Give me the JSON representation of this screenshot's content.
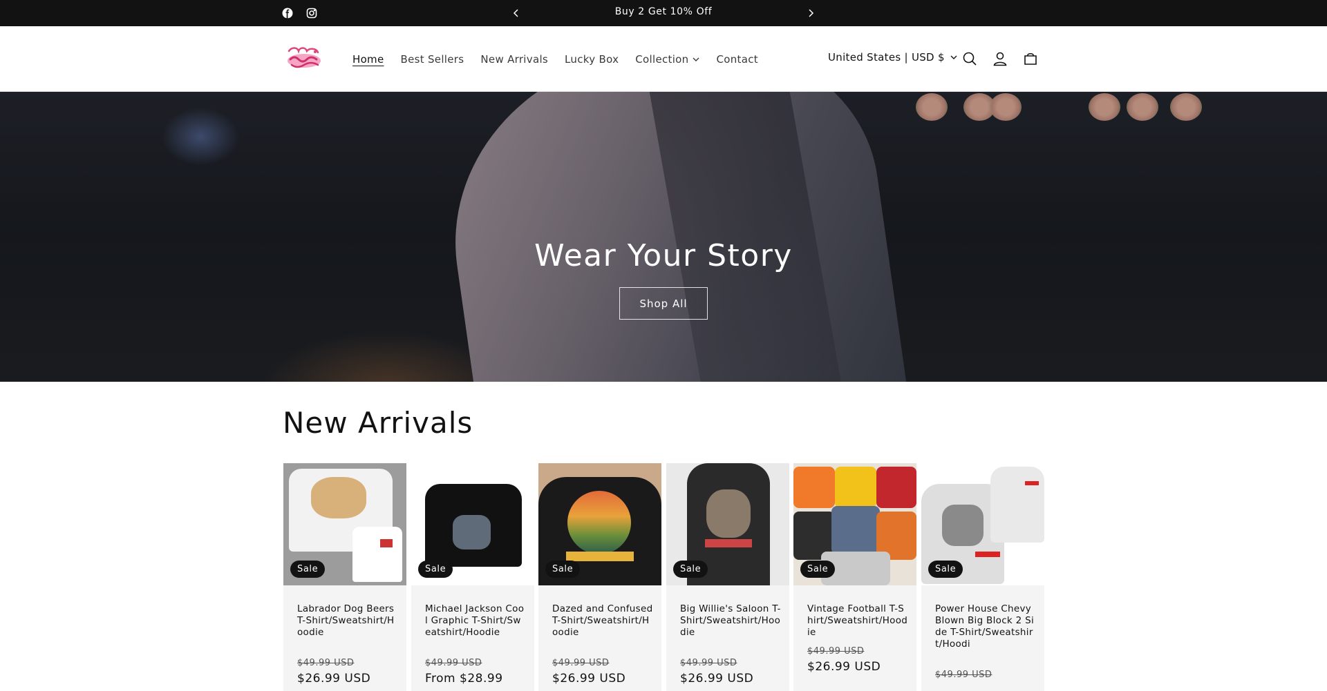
{
  "announcement": {
    "text": "Buy 2 Get 10% Off",
    "social": [
      "facebook-icon",
      "instagram-icon"
    ]
  },
  "header": {
    "logo_alt": "Vara Femme",
    "nav": [
      {
        "label": "Home",
        "active": true
      },
      {
        "label": "Best Sellers"
      },
      {
        "label": "New Arrivals"
      },
      {
        "label": "Lucky Box"
      },
      {
        "label": "Collection",
        "has_dropdown": true
      },
      {
        "label": "Contact"
      }
    ],
    "currency": "United States | USD $",
    "icons": [
      "search-icon",
      "account-icon",
      "cart-icon"
    ]
  },
  "hero": {
    "title": "Wear Your Story",
    "button": "Shop All"
  },
  "new_arrivals": {
    "title": "New Arrivals",
    "products": [
      {
        "badge": "Sale",
        "name": "Labrador Dog Beers T-Shirt/Sweatshirt/Hoodie",
        "old_price": "$49.99 USD",
        "price": "$26.99 USD"
      },
      {
        "badge": "Sale",
        "name": "Michael Jackson Cool Graphic T-Shirt/Sweatshirt/Hoodie",
        "old_price": "$49.99 USD",
        "price": "From $28.99"
      },
      {
        "badge": "Sale",
        "name": "Dazed and Confused T-Shirt/Sweatshirt/Hoodie",
        "old_price": "$49.99 USD",
        "price": "$26.99 USD"
      },
      {
        "badge": "Sale",
        "name": "Big Willie's Saloon T-Shirt/Sweatshirt/Hoodie",
        "old_price": "$49.99 USD",
        "price": "$26.99 USD"
      },
      {
        "badge": "Sale",
        "name": "Vintage Football T-Shirt/Sweatshirt/Hoodie",
        "old_price": "$49.99 USD",
        "price": "$26.99 USD"
      },
      {
        "badge": "Sale",
        "name": "Power House Chevy Blown Big Block 2 Side T-Shirt/Sweatshirt/Hoodi",
        "old_price": "$49.99 USD",
        "price": ""
      }
    ]
  }
}
